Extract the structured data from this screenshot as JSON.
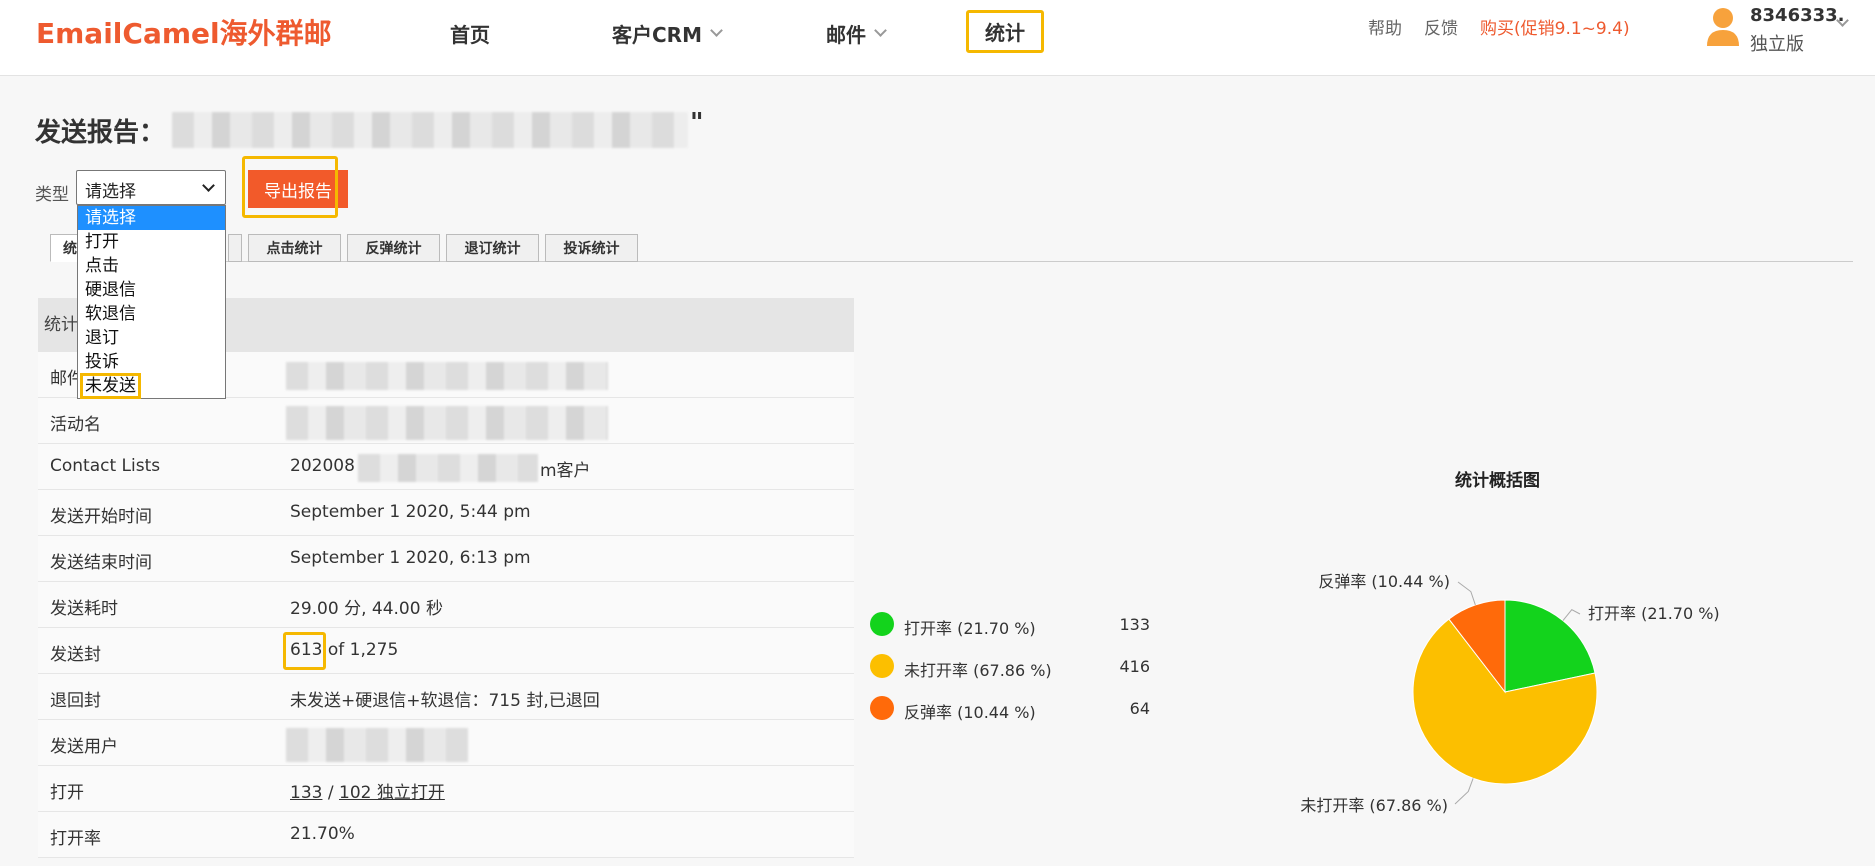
{
  "header": {
    "brand": "EmailCamel海外群邮",
    "nav": [
      {
        "label": "首页"
      },
      {
        "label": "客户CRM"
      },
      {
        "label": "邮件"
      },
      {
        "label": "统计"
      }
    ],
    "help": "帮助",
    "feedback": "反馈",
    "buy": "购买(促销9.1~9.4)",
    "user_id": "8346333.",
    "user_edition": "独立版"
  },
  "report": {
    "title": "发送报告：",
    "title_end": "\"",
    "type_label": "类型",
    "select_value": "请选择",
    "options": [
      "请选择",
      "打开",
      "点击",
      "硬退信",
      "软退信",
      "退订",
      "投诉",
      "未发送"
    ],
    "export_button": "导出报告"
  },
  "tabs": [
    {
      "label": "统"
    },
    {
      "label": ""
    },
    {
      "label": "点击统计"
    },
    {
      "label": "反弹统计"
    },
    {
      "label": "退订统计"
    },
    {
      "label": "投诉统计"
    }
  ],
  "table": {
    "header": "统计",
    "rows": [
      {
        "key": "邮件",
        "value": ""
      },
      {
        "key": "活动名",
        "value": ""
      },
      {
        "key": "Contact Lists",
        "value_prefix": "202008",
        "value_suffix": "m客户"
      },
      {
        "key": "发送开始时间",
        "value": "September 1 2020, 5:44 pm"
      },
      {
        "key": "发送结束时间",
        "value": "September 1 2020, 6:13 pm"
      },
      {
        "key": "发送耗时",
        "value": "29.00 分, 44.00 秒"
      },
      {
        "key": "发送封",
        "value_highlight": "613",
        "value_rest": " of 1,275"
      },
      {
        "key": "退回封",
        "value": "未发送+硬退信+软退信：715 封,已退回"
      },
      {
        "key": "发送用户",
        "value": ""
      },
      {
        "key": "打开",
        "value_link1": "133",
        "value_sep": " / ",
        "value_link2": "102 独立打开"
      },
      {
        "key": "打开率",
        "value": "21.70%"
      }
    ]
  },
  "chart_data": {
    "type": "pie",
    "title": "统计概括图",
    "slices": [
      {
        "name": "打开率 (21.70 %)",
        "value": 133,
        "percent": 21.7,
        "color": "#13d31c"
      },
      {
        "name": "未打开率 (67.86 %)",
        "value": 416,
        "percent": 67.86,
        "color": "#fcbf00"
      },
      {
        "name": "反弹率 (10.44 %)",
        "value": 64,
        "percent": 10.44,
        "color": "#ff6a0a"
      }
    ]
  }
}
